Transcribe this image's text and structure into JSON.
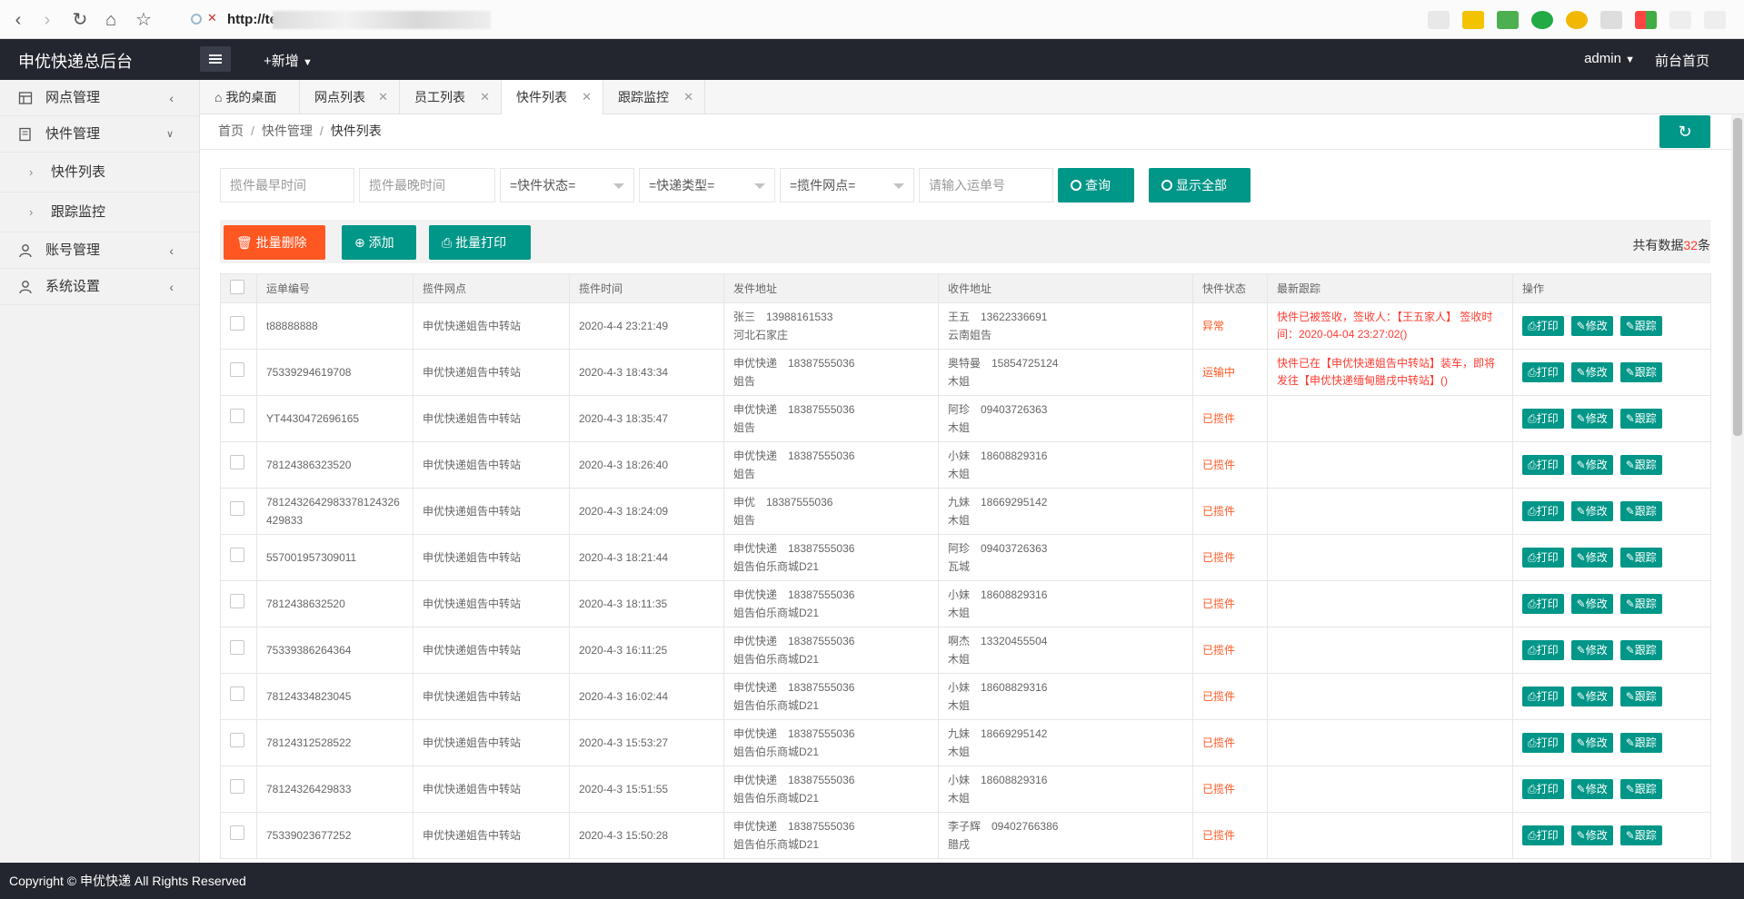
{
  "browser": {
    "url": "http://test5",
    "nav": {
      "back": "‹",
      "forward": "›",
      "reload": "↻",
      "home": "⌂",
      "star": "☆"
    }
  },
  "header": {
    "app_title": "申优快递总后台",
    "new_label": "+新增",
    "user_label": "admin",
    "home_link": "前台首页"
  },
  "sidebar": {
    "items": [
      {
        "label": "网点管理",
        "icon": "store-icon"
      },
      {
        "label": "快件管理",
        "icon": "package-icon"
      },
      {
        "label": "快件列表"
      },
      {
        "label": "跟踪监控"
      },
      {
        "label": "账号管理",
        "icon": "user-icon"
      },
      {
        "label": "系统设置",
        "icon": "user-icon"
      }
    ]
  },
  "tabs": [
    {
      "label": "我的桌面"
    },
    {
      "label": "网点列表"
    },
    {
      "label": "员工列表"
    },
    {
      "label": "快件列表"
    },
    {
      "label": "跟踪监控"
    }
  ],
  "breadcrumb": {
    "home": "首页",
    "level1": "快件管理",
    "level2": "快件列表"
  },
  "filters": {
    "start_time_placeholder": "揽件最早时间",
    "end_time_placeholder": "揽件最晚时间",
    "status_select": "=快件状态=",
    "type_select": "=快递类型=",
    "station_select": "=揽件网点=",
    "tracking_placeholder": "请输入运单号",
    "query_label": "查询",
    "show_all_label": "显示全部"
  },
  "toolbar": {
    "batch_delete": "批量删除",
    "add": "添加",
    "batch_print": "批量打印",
    "total_prefix": "共有数据",
    "total_count": "32",
    "total_suffix": "条"
  },
  "table": {
    "headers": [
      "运单编号",
      "揽件网点",
      "揽件时间",
      "发件地址",
      "收件地址",
      "快件状态",
      "最新跟踪",
      "操作"
    ],
    "op_labels": {
      "print": "打印",
      "edit": "修改",
      "track": "跟踪"
    },
    "rows": [
      {
        "id": "t88888888",
        "station": "申优快递姐告中转站",
        "time": "2020-4-4 23:21:49",
        "sender": "张三　13988161533",
        "sender_addr": "河北石家庄",
        "receiver": "王五　13622336691",
        "receiver_addr": "云南姐告",
        "status": "异常",
        "track1": "快件已被签收，签收人：【王五家人】 签收时",
        "track2": "间：2020-04-04 23:27:02()"
      },
      {
        "id": "75339294619708",
        "station": "申优快递姐告中转站",
        "time": "2020-4-3 18:43:34",
        "sender": "申优快递　18387555036",
        "sender_addr": "姐告",
        "receiver": "奥特曼　15854725124",
        "receiver_addr": "木姐",
        "status": "运输中",
        "track1": "快件已在【申优快递姐告中转站】装车，即将",
        "track2": "发往【申优快递缅甸腊戌中转站】()"
      },
      {
        "id": "YT4430472696165",
        "station": "申优快递姐告中转站",
        "time": "2020-4-3 18:35:47",
        "sender": "申优快递　18387555036",
        "sender_addr": "姐告",
        "receiver": "阿珍　09403726363",
        "receiver_addr": "木姐",
        "status": "已揽件",
        "track1": "",
        "track2": ""
      },
      {
        "id": "78124386323520",
        "station": "申优快递姐告中转站",
        "time": "2020-4-3 18:26:40",
        "sender": "申优快递　18387555036",
        "sender_addr": "姐告",
        "receiver": "小妹　18608829316",
        "receiver_addr": "木姐",
        "status": "已揽件",
        "track1": "",
        "track2": ""
      },
      {
        "id": "7812432642983378124326",
        "id2": "429833",
        "station": "申优快递姐告中转站",
        "time": "2020-4-3 18:24:09",
        "sender": "申优　18387555036",
        "sender_addr": "姐告",
        "receiver": "九妹　18669295142",
        "receiver_addr": "木姐",
        "status": "已揽件",
        "track1": "",
        "track2": ""
      },
      {
        "id": "557001957309011",
        "station": "申优快递姐告中转站",
        "time": "2020-4-3 18:21:44",
        "sender": "申优快递　18387555036",
        "sender_addr": "姐告伯乐商城D21",
        "receiver": "阿珍　09403726363",
        "receiver_addr": "瓦城",
        "status": "已揽件",
        "track1": "",
        "track2": ""
      },
      {
        "id": "7812438632520",
        "station": "申优快递姐告中转站",
        "time": "2020-4-3 18:11:35",
        "sender": "申优快递　18387555036",
        "sender_addr": "姐告伯乐商城D21",
        "receiver": "小妹　18608829316",
        "receiver_addr": "木姐",
        "status": "已揽件",
        "track1": "",
        "track2": ""
      },
      {
        "id": "75339386264364",
        "station": "申优快递姐告中转站",
        "time": "2020-4-3 16:11:25",
        "sender": "申优快递　18387555036",
        "sender_addr": "姐告伯乐商城D21",
        "receiver": "啊杰　13320455504",
        "receiver_addr": "木姐",
        "status": "已揽件",
        "track1": "",
        "track2": ""
      },
      {
        "id": "78124334823045",
        "station": "申优快递姐告中转站",
        "time": "2020-4-3 16:02:44",
        "sender": "申优快递　18387555036",
        "sender_addr": "姐告伯乐商城D21",
        "receiver": "小妹　18608829316",
        "receiver_addr": "木姐",
        "status": "已揽件",
        "track1": "",
        "track2": ""
      },
      {
        "id": "78124312528522",
        "station": "申优快递姐告中转站",
        "time": "2020-4-3 15:53:27",
        "sender": "申优快递　18387555036",
        "sender_addr": "姐告伯乐商城D21",
        "receiver": "九妹　18669295142",
        "receiver_addr": "木姐",
        "status": "已揽件",
        "track1": "",
        "track2": ""
      },
      {
        "id": "78124326429833",
        "station": "申优快递姐告中转站",
        "time": "2020-4-3 15:51:55",
        "sender": "申优快递　18387555036",
        "sender_addr": "姐告伯乐商城D21",
        "receiver": "小妹　18608829316",
        "receiver_addr": "木姐",
        "status": "已揽件",
        "track1": "",
        "track2": ""
      },
      {
        "id": "75339023677252",
        "station": "申优快递姐告中转站",
        "time": "2020-4-3 15:50:28",
        "sender": "申优快递　18387555036",
        "sender_addr": "姐告伯乐商城D21",
        "receiver": "李子辉　09402766386",
        "receiver_addr": "腊戌",
        "status": "已揽件",
        "track1": "",
        "track2": ""
      }
    ]
  },
  "footer": {
    "copyright": "Copyright © 申优快递 All Rights Reserved"
  },
  "colors": {
    "accent": "#009688",
    "danger": "#ff5722",
    "header_bg": "#23262e"
  }
}
